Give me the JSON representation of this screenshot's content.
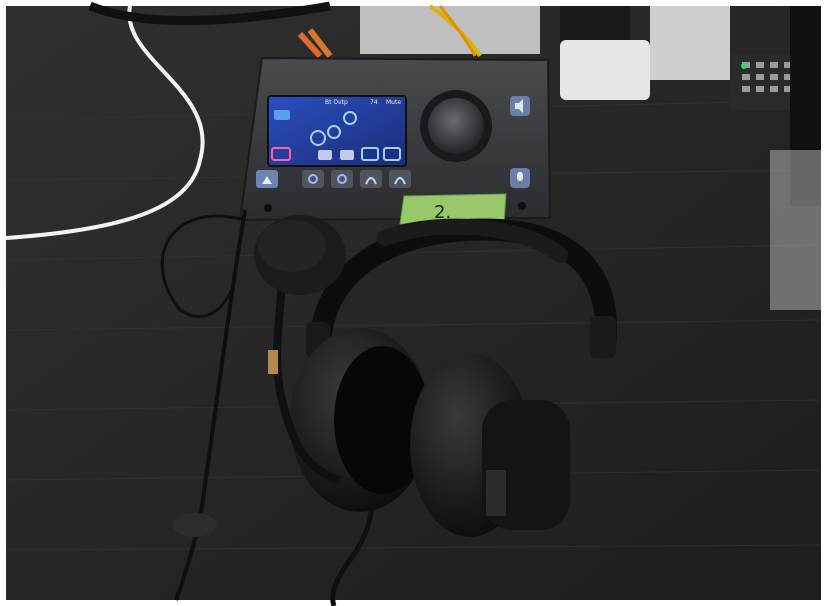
{
  "photo": {
    "scene": "headset-and-audio-interface-on-desk"
  },
  "interface": {
    "screen_title": "Bt Ovtp",
    "screen_status_left": "74",
    "screen_status_right": "Mute"
  },
  "tape_label": "2.",
  "colors": {
    "desk": "#2a2a2a",
    "desk_dark": "#1c1c1c",
    "device_body": "#3a3b3e",
    "screen_bg": "#243a8f",
    "tape": "#97c86a",
    "headset": "#111111"
  }
}
